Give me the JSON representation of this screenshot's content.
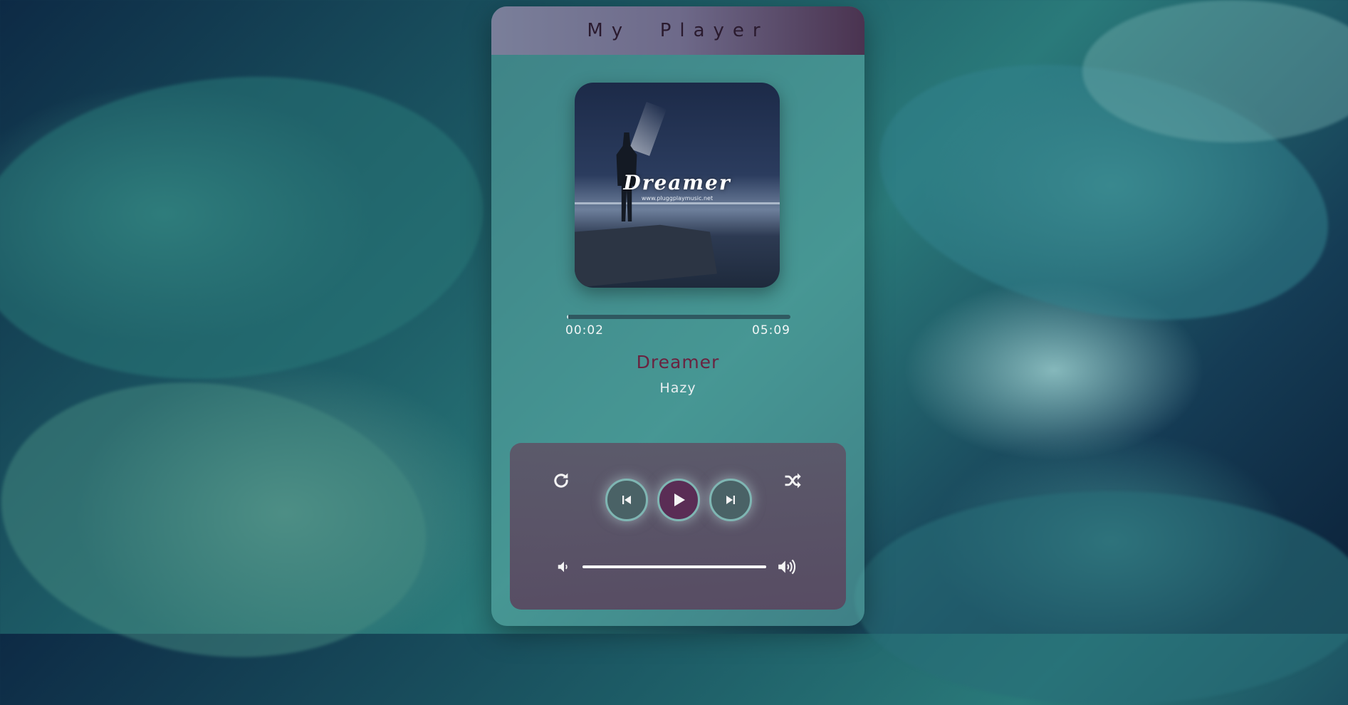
{
  "app": {
    "title": "My  Player"
  },
  "track": {
    "title": "Dreamer",
    "artist": "Hazy",
    "cover": {
      "title_art": "Dreamer",
      "url_art": "www.pluggplaymusic.net"
    }
  },
  "progress": {
    "current": "00:02",
    "total": "05:09",
    "fraction": 0.006
  },
  "volume": {
    "fraction": 1.0
  },
  "icons": {
    "repeat": "repeat-icon",
    "previous": "skip-previous-icon",
    "play": "play-icon",
    "next": "skip-next-icon",
    "shuffle": "shuffle-icon",
    "volume_low": "volume-low-icon",
    "volume_high": "volume-high-icon"
  },
  "colors": {
    "header_gradient_start": "#7a7f9a",
    "header_gradient_end": "#4a3350",
    "song_title": "#6a2340",
    "play_button": "#5a2d55",
    "nav_buttons": "#4a6266",
    "button_ring": "#7fb6b3"
  }
}
